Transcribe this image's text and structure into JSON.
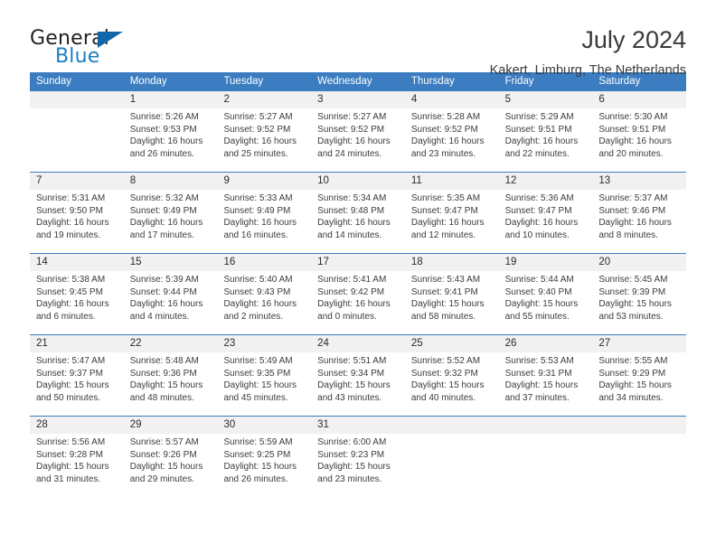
{
  "logo": {
    "primary_text": "General",
    "secondary_text": "Blue",
    "triangle_color": "#1266ab",
    "primary_color": "#231f20",
    "secondary_color": "#1c7fc4"
  },
  "header": {
    "title": "July 2024",
    "subtitle": "Kakert, Limburg, The Netherlands"
  },
  "theme": {
    "header_blue": "#3b7dc0",
    "day_band_gray": "#f1f1f1",
    "text_color": "#3c3c3c"
  },
  "weekdays": [
    "Sunday",
    "Monday",
    "Tuesday",
    "Wednesday",
    "Thursday",
    "Friday",
    "Saturday"
  ],
  "weeks": [
    [
      {
        "day": "",
        "sunrise": "",
        "sunset": "",
        "daylight_line1": "",
        "daylight_line2": ""
      },
      {
        "day": "1",
        "sunrise": "Sunrise: 5:26 AM",
        "sunset": "Sunset: 9:53 PM",
        "daylight_line1": "Daylight: 16 hours",
        "daylight_line2": "and 26 minutes."
      },
      {
        "day": "2",
        "sunrise": "Sunrise: 5:27 AM",
        "sunset": "Sunset: 9:52 PM",
        "daylight_line1": "Daylight: 16 hours",
        "daylight_line2": "and 25 minutes."
      },
      {
        "day": "3",
        "sunrise": "Sunrise: 5:27 AM",
        "sunset": "Sunset: 9:52 PM",
        "daylight_line1": "Daylight: 16 hours",
        "daylight_line2": "and 24 minutes."
      },
      {
        "day": "4",
        "sunrise": "Sunrise: 5:28 AM",
        "sunset": "Sunset: 9:52 PM",
        "daylight_line1": "Daylight: 16 hours",
        "daylight_line2": "and 23 minutes."
      },
      {
        "day": "5",
        "sunrise": "Sunrise: 5:29 AM",
        "sunset": "Sunset: 9:51 PM",
        "daylight_line1": "Daylight: 16 hours",
        "daylight_line2": "and 22 minutes."
      },
      {
        "day": "6",
        "sunrise": "Sunrise: 5:30 AM",
        "sunset": "Sunset: 9:51 PM",
        "daylight_line1": "Daylight: 16 hours",
        "daylight_line2": "and 20 minutes."
      }
    ],
    [
      {
        "day": "7",
        "sunrise": "Sunrise: 5:31 AM",
        "sunset": "Sunset: 9:50 PM",
        "daylight_line1": "Daylight: 16 hours",
        "daylight_line2": "and 19 minutes."
      },
      {
        "day": "8",
        "sunrise": "Sunrise: 5:32 AM",
        "sunset": "Sunset: 9:49 PM",
        "daylight_line1": "Daylight: 16 hours",
        "daylight_line2": "and 17 minutes."
      },
      {
        "day": "9",
        "sunrise": "Sunrise: 5:33 AM",
        "sunset": "Sunset: 9:49 PM",
        "daylight_line1": "Daylight: 16 hours",
        "daylight_line2": "and 16 minutes."
      },
      {
        "day": "10",
        "sunrise": "Sunrise: 5:34 AM",
        "sunset": "Sunset: 9:48 PM",
        "daylight_line1": "Daylight: 16 hours",
        "daylight_line2": "and 14 minutes."
      },
      {
        "day": "11",
        "sunrise": "Sunrise: 5:35 AM",
        "sunset": "Sunset: 9:47 PM",
        "daylight_line1": "Daylight: 16 hours",
        "daylight_line2": "and 12 minutes."
      },
      {
        "day": "12",
        "sunrise": "Sunrise: 5:36 AM",
        "sunset": "Sunset: 9:47 PM",
        "daylight_line1": "Daylight: 16 hours",
        "daylight_line2": "and 10 minutes."
      },
      {
        "day": "13",
        "sunrise": "Sunrise: 5:37 AM",
        "sunset": "Sunset: 9:46 PM",
        "daylight_line1": "Daylight: 16 hours",
        "daylight_line2": "and 8 minutes."
      }
    ],
    [
      {
        "day": "14",
        "sunrise": "Sunrise: 5:38 AM",
        "sunset": "Sunset: 9:45 PM",
        "daylight_line1": "Daylight: 16 hours",
        "daylight_line2": "and 6 minutes."
      },
      {
        "day": "15",
        "sunrise": "Sunrise: 5:39 AM",
        "sunset": "Sunset: 9:44 PM",
        "daylight_line1": "Daylight: 16 hours",
        "daylight_line2": "and 4 minutes."
      },
      {
        "day": "16",
        "sunrise": "Sunrise: 5:40 AM",
        "sunset": "Sunset: 9:43 PM",
        "daylight_line1": "Daylight: 16 hours",
        "daylight_line2": "and 2 minutes."
      },
      {
        "day": "17",
        "sunrise": "Sunrise: 5:41 AM",
        "sunset": "Sunset: 9:42 PM",
        "daylight_line1": "Daylight: 16 hours",
        "daylight_line2": "and 0 minutes."
      },
      {
        "day": "18",
        "sunrise": "Sunrise: 5:43 AM",
        "sunset": "Sunset: 9:41 PM",
        "daylight_line1": "Daylight: 15 hours",
        "daylight_line2": "and 58 minutes."
      },
      {
        "day": "19",
        "sunrise": "Sunrise: 5:44 AM",
        "sunset": "Sunset: 9:40 PM",
        "daylight_line1": "Daylight: 15 hours",
        "daylight_line2": "and 55 minutes."
      },
      {
        "day": "20",
        "sunrise": "Sunrise: 5:45 AM",
        "sunset": "Sunset: 9:39 PM",
        "daylight_line1": "Daylight: 15 hours",
        "daylight_line2": "and 53 minutes."
      }
    ],
    [
      {
        "day": "21",
        "sunrise": "Sunrise: 5:47 AM",
        "sunset": "Sunset: 9:37 PM",
        "daylight_line1": "Daylight: 15 hours",
        "daylight_line2": "and 50 minutes."
      },
      {
        "day": "22",
        "sunrise": "Sunrise: 5:48 AM",
        "sunset": "Sunset: 9:36 PM",
        "daylight_line1": "Daylight: 15 hours",
        "daylight_line2": "and 48 minutes."
      },
      {
        "day": "23",
        "sunrise": "Sunrise: 5:49 AM",
        "sunset": "Sunset: 9:35 PM",
        "daylight_line1": "Daylight: 15 hours",
        "daylight_line2": "and 45 minutes."
      },
      {
        "day": "24",
        "sunrise": "Sunrise: 5:51 AM",
        "sunset": "Sunset: 9:34 PM",
        "daylight_line1": "Daylight: 15 hours",
        "daylight_line2": "and 43 minutes."
      },
      {
        "day": "25",
        "sunrise": "Sunrise: 5:52 AM",
        "sunset": "Sunset: 9:32 PM",
        "daylight_line1": "Daylight: 15 hours",
        "daylight_line2": "and 40 minutes."
      },
      {
        "day": "26",
        "sunrise": "Sunrise: 5:53 AM",
        "sunset": "Sunset: 9:31 PM",
        "daylight_line1": "Daylight: 15 hours",
        "daylight_line2": "and 37 minutes."
      },
      {
        "day": "27",
        "sunrise": "Sunrise: 5:55 AM",
        "sunset": "Sunset: 9:29 PM",
        "daylight_line1": "Daylight: 15 hours",
        "daylight_line2": "and 34 minutes."
      }
    ],
    [
      {
        "day": "28",
        "sunrise": "Sunrise: 5:56 AM",
        "sunset": "Sunset: 9:28 PM",
        "daylight_line1": "Daylight: 15 hours",
        "daylight_line2": "and 31 minutes."
      },
      {
        "day": "29",
        "sunrise": "Sunrise: 5:57 AM",
        "sunset": "Sunset: 9:26 PM",
        "daylight_line1": "Daylight: 15 hours",
        "daylight_line2": "and 29 minutes."
      },
      {
        "day": "30",
        "sunrise": "Sunrise: 5:59 AM",
        "sunset": "Sunset: 9:25 PM",
        "daylight_line1": "Daylight: 15 hours",
        "daylight_line2": "and 26 minutes."
      },
      {
        "day": "31",
        "sunrise": "Sunrise: 6:00 AM",
        "sunset": "Sunset: 9:23 PM",
        "daylight_line1": "Daylight: 15 hours",
        "daylight_line2": "and 23 minutes."
      },
      {
        "day": "",
        "sunrise": "",
        "sunset": "",
        "daylight_line1": "",
        "daylight_line2": ""
      },
      {
        "day": "",
        "sunrise": "",
        "sunset": "",
        "daylight_line1": "",
        "daylight_line2": ""
      },
      {
        "day": "",
        "sunrise": "",
        "sunset": "",
        "daylight_line1": "",
        "daylight_line2": ""
      }
    ]
  ]
}
